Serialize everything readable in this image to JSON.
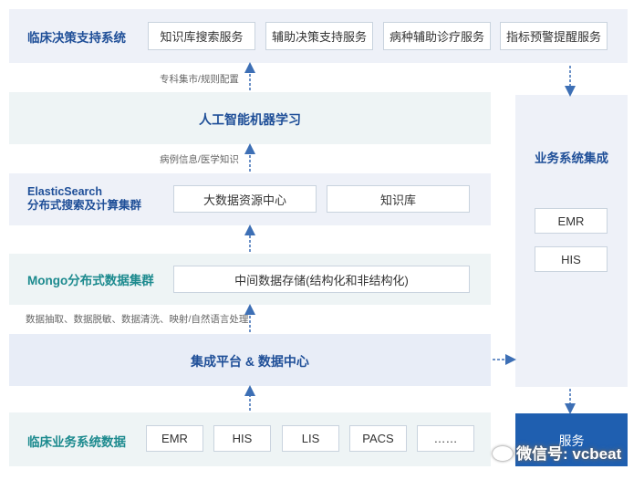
{
  "cdss": {
    "title": "临床决策支持系统",
    "services": [
      "知识库搜索服务",
      "辅助决策支持服务",
      "病种辅助诊疗服务",
      "指标预警提醒服务"
    ]
  },
  "note_top": "专科集市/规则配置",
  "ai": {
    "title": "人工智能机器学习"
  },
  "note_ai_es": "病例信息/医学知识",
  "es": {
    "title_line1": "ElasticSearch",
    "title_line2": "分布式搜索及计算集群",
    "items": [
      "大数据资源中心",
      "知识库"
    ]
  },
  "mongo": {
    "title": "Mongo分布式数据集群",
    "storage": "中间数据存储(结构化和非结构化)"
  },
  "note_etl": "数据抽取、数据脱敏、数据清洗、映射/自然语言处理",
  "integration": {
    "title": "集成平台 & 数据中心"
  },
  "sources": {
    "title": "临床业务系统数据",
    "items": [
      "EMR",
      "HIS",
      "LIS",
      "PACS",
      "……"
    ]
  },
  "biz": {
    "title": "业务系统集成",
    "items": [
      "EMR",
      "HIS"
    ]
  },
  "service": {
    "label": "服务"
  },
  "watermark": {
    "text": "微信号: vcbeat"
  },
  "colors": {
    "title_blue": "#1f4f98",
    "title_green": "#1c8a8e",
    "service_blue": "#1f5fb0",
    "arrow": "#3d6fb5"
  }
}
